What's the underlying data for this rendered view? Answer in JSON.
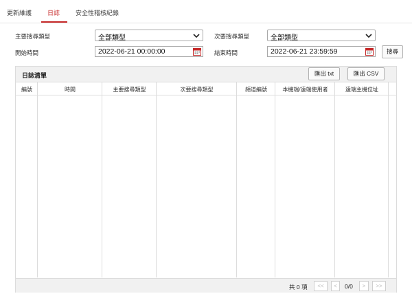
{
  "tabs": [
    {
      "label": "更新維護"
    },
    {
      "label": "日誌"
    },
    {
      "label": "安全性稽核紀錄"
    }
  ],
  "filters": {
    "main_type_label": "主要搜尋類型",
    "main_type_value": "全部類型",
    "sub_type_label": "次要搜尋類型",
    "sub_type_value": "全部類型",
    "start_label": "開始時間",
    "start_value": "2022-06-21 00:00:00",
    "end_label": "結束時間",
    "end_value": "2022-06-21 23:59:59",
    "search_button": "搜尋"
  },
  "log_list": {
    "title": "日誌清單",
    "export_txt": "匯出 txt",
    "export_csv": "匯出 CSV",
    "columns": [
      "編號",
      "時間",
      "主要搜尋類型",
      "次要搜尋類型",
      "頻道編號",
      "本機端/遠端使用者",
      "遠端主機位址"
    ]
  },
  "pager": {
    "total": "共 0 項",
    "first": "<<",
    "prev": "<",
    "page": "0/0",
    "next": ">",
    "last": ">>"
  },
  "colors": {
    "accent": "#c62828",
    "panel_header": "#f1f1f1",
    "border": "#dcdcdc"
  },
  "icons": [
    "chevron-down-icon",
    "calendar-icon"
  ]
}
